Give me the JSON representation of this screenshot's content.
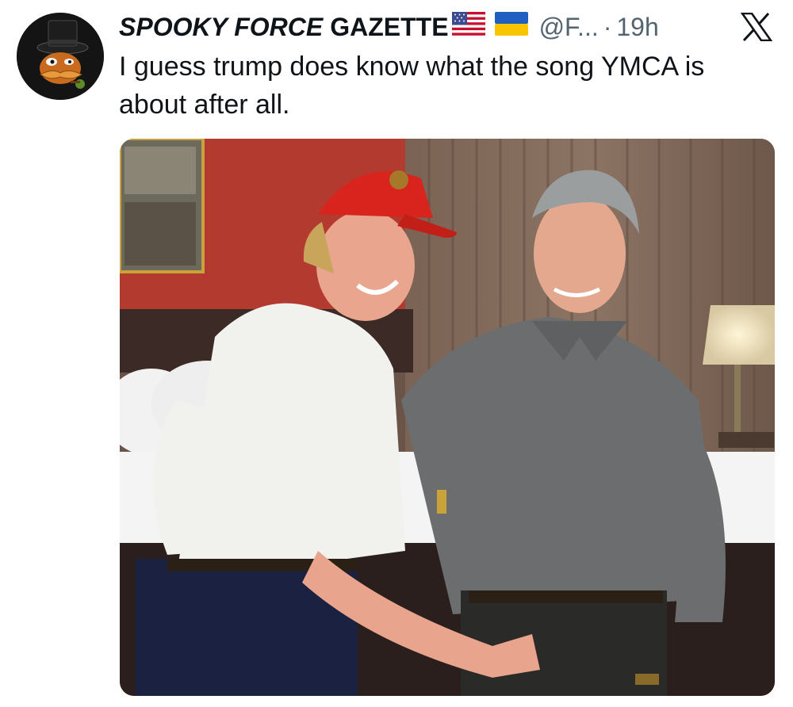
{
  "tweet": {
    "display_name_part1": "SPOOKY FORCE",
    "display_name_part2": "GAZETTE",
    "flags": [
      "us-flag-icon",
      "ukraine-flag-icon"
    ],
    "handle": "@F...",
    "separator": "·",
    "time": "19h",
    "text": "I guess trump does know what the song YMCA is about after all.",
    "platform_logo": "x-logo-icon",
    "avatar_icon": "cartoon-villain-avatar",
    "media": {
      "type": "photo",
      "description_icon": "photo-two-men-in-hotel-room"
    }
  },
  "colors": {
    "text_primary": "#0f1419",
    "text_secondary": "#536471",
    "background": "#ffffff"
  }
}
